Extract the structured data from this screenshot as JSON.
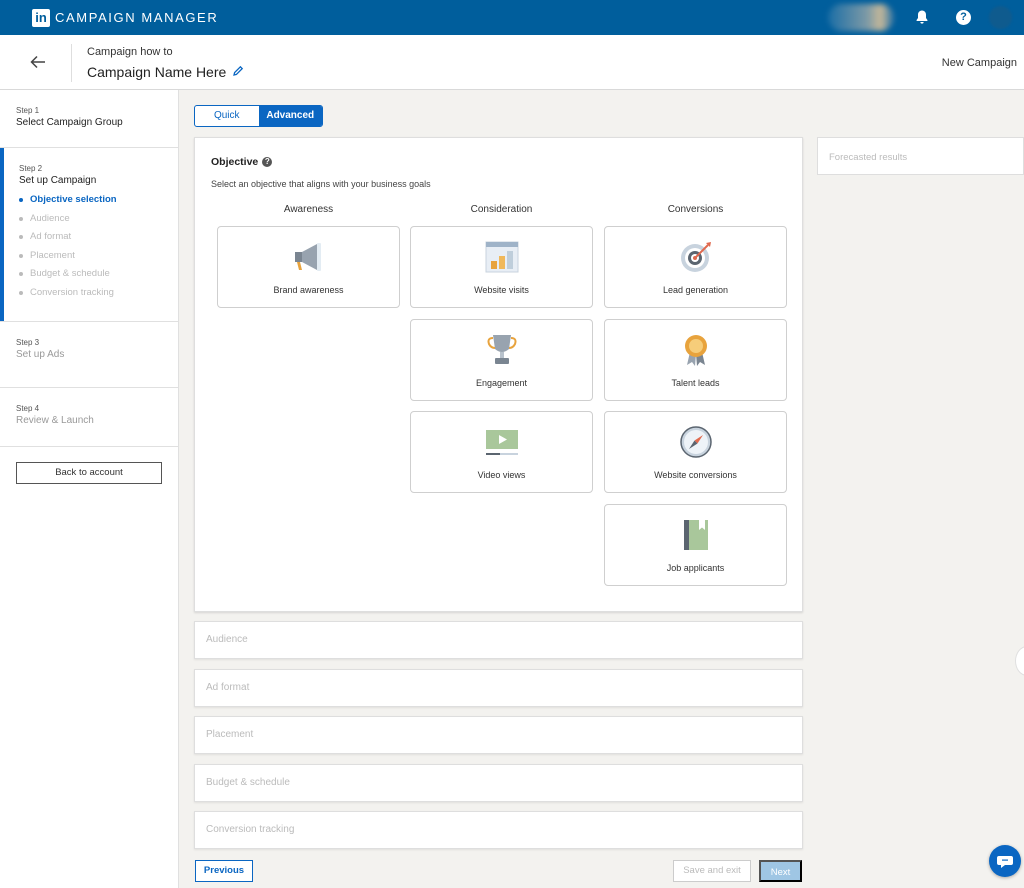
{
  "topbar": {
    "logo_text": "in",
    "brand": "CAMPAIGN MANAGER",
    "icons": [
      "bell-icon",
      "help-icon",
      "avatar"
    ]
  },
  "header": {
    "subtitle": "Campaign how to",
    "title": "Campaign Name Here",
    "new_campaign": "New Campaign"
  },
  "sidebar": {
    "steps": [
      {
        "label": "Step 1",
        "title": "Select Campaign Group"
      },
      {
        "label": "Step 2",
        "title": "Set up Campaign",
        "substeps": [
          "Objective selection",
          "Audience",
          "Ad format",
          "Placement",
          "Budget & schedule",
          "Conversion tracking"
        ]
      },
      {
        "label": "Step 3",
        "title": "Set up Ads"
      },
      {
        "label": "Step 4",
        "title": "Review & Launch"
      }
    ],
    "back_button": "Back to account"
  },
  "mode_toggle": {
    "quick": "Quick",
    "advanced": "Advanced",
    "selected": "Advanced"
  },
  "objective": {
    "title": "Objective",
    "subtitle": "Select an objective that aligns with your business goals",
    "columns": [
      {
        "heading": "Awareness",
        "cards": [
          "Brand awareness"
        ]
      },
      {
        "heading": "Consideration",
        "cards": [
          "Website visits",
          "Engagement",
          "Video views"
        ]
      },
      {
        "heading": "Conversions",
        "cards": [
          "Lead generation",
          "Talent leads",
          "Website conversions",
          "Job applicants"
        ]
      }
    ]
  },
  "sections": [
    "Audience",
    "Ad format",
    "Placement",
    "Budget & schedule",
    "Conversion tracking"
  ],
  "forecast": {
    "title": "Forecasted results"
  },
  "buttons": {
    "previous": "Previous",
    "save_exit": "Save and exit",
    "next": "Next"
  },
  "colors": {
    "topbar": "#005e9c",
    "accent": "#0a66c2"
  }
}
